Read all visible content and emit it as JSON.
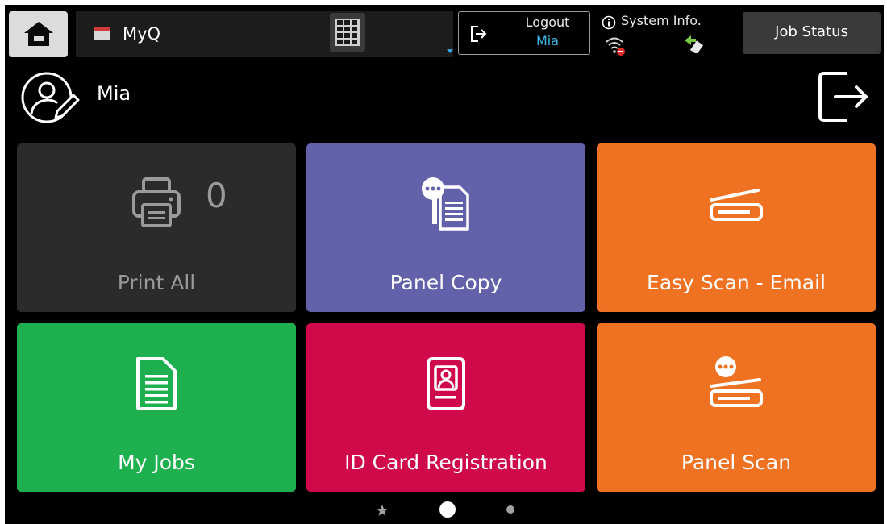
{
  "header": {
    "app_name": "MyQ",
    "logout_label": "Logout",
    "logout_user": "Mia",
    "system_info_label": "System Info.",
    "job_status_label": "Job Status"
  },
  "user": {
    "name": "Mia"
  },
  "tiles": [
    {
      "label": "Print All",
      "count": "0",
      "color": "#2b2b2b",
      "icon": "printer-icon"
    },
    {
      "label": "Panel Copy",
      "color": "#6461ab",
      "icon": "copy-document-icon"
    },
    {
      "label": "Easy Scan - Email",
      "color": "#ef7122",
      "icon": "scanner-icon"
    },
    {
      "label": "My Jobs",
      "color": "#1eb04f",
      "icon": "document-icon"
    },
    {
      "label": "ID Card Registration",
      "color": "#d00a4a",
      "icon": "id-card-icon"
    },
    {
      "label": "Panel Scan",
      "color": "#ef7122",
      "icon": "scanner-chat-icon"
    }
  ],
  "pager": {
    "pages": 3,
    "current": 2
  },
  "colors": {
    "accent_blue": "#3fb6e8",
    "background": "#000000"
  }
}
